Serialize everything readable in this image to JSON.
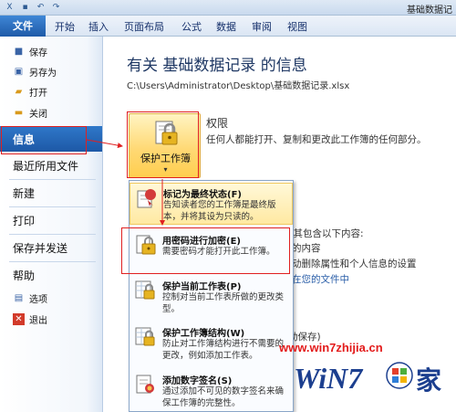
{
  "window_title": "基础数据记",
  "tabs": [
    "文件",
    "开始",
    "插入",
    "页面布局",
    "公式",
    "数据",
    "审阅",
    "视图"
  ],
  "nav": {
    "save": "保存",
    "saveas": "另存为",
    "open": "打开",
    "close": "关闭",
    "info": "信息",
    "recent": "最近所用文件",
    "new": "新建",
    "print": "打印",
    "send": "保存并发送",
    "help": "帮助",
    "options": "选项",
    "exit": "退出"
  },
  "main": {
    "heading": "有关 基础数据记录 的信息",
    "path": "C:\\Users\\Administrator\\Desktop\\基础数据记录.xlsx",
    "protect_label": "保护工作簿",
    "permissions_title": "权限",
    "permissions_desc": "任何人都能打开、复制和更改此工作簿的任何部分。",
    "bg_line1": "意其包含以下内容:",
    "bg_line2": "的内容",
    "bg_line3": "动删除属性和个人信息的设置",
    "bg_line4": "在您的文件中",
    "bg_line5": "动保存)"
  },
  "menu": {
    "items": [
      {
        "title": "标记为最终状态(F)",
        "desc": "告知读者您的工作簿是最终版本，并将其设为只读的。"
      },
      {
        "title": "用密码进行加密(E)",
        "desc": "需要密码才能打开此工作簿。"
      },
      {
        "title": "保护当前工作表(P)",
        "desc": "控制对当前工作表所做的更改类型。"
      },
      {
        "title": "保护工作簿结构(W)",
        "desc": "防止对工作簿结构进行不需要的更改，例如添加工作表。"
      },
      {
        "title": "添加数字签名(S)",
        "desc": "通过添加不可见的数字签名来确保工作簿的完整性。"
      }
    ]
  },
  "watermark": {
    "url": "www.win7zhijia.cn",
    "logo_text": "WiN7",
    "logo_char": "家"
  },
  "colors": {
    "accent": "#1d58a6",
    "annotation_red": "#e02020",
    "highlight": "#ffe9a2"
  }
}
